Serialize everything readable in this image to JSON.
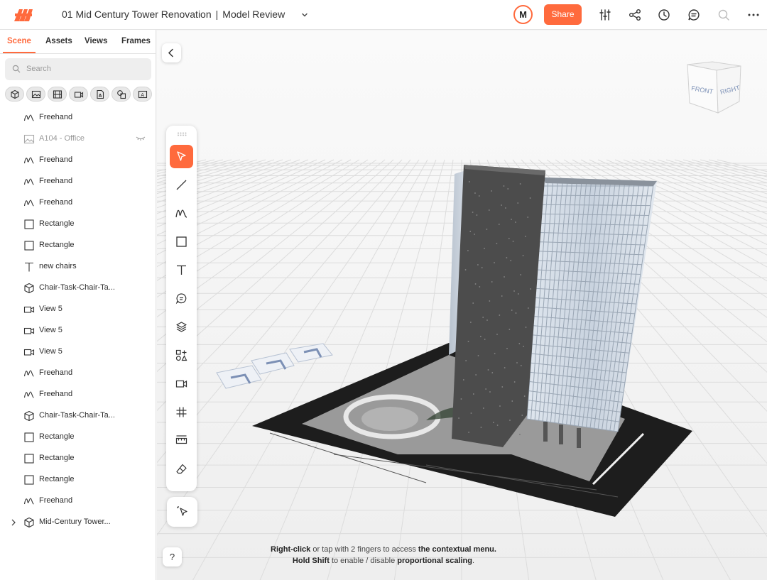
{
  "app": {
    "project_name": "01 Mid Century Tower Renovation",
    "separator": "|",
    "view_name": "Model Review"
  },
  "header": {
    "avatar_initial": "M",
    "share_label": "Share",
    "icons": [
      "settings-sliders-icon",
      "share-icon",
      "history-icon",
      "comment-icon",
      "search-icon",
      "more-icon"
    ]
  },
  "sidebar": {
    "tabs": [
      {
        "label": "Scene",
        "active": true
      },
      {
        "label": "Assets",
        "active": false
      },
      {
        "label": "Views",
        "active": false
      },
      {
        "label": "Frames",
        "active": false
      }
    ],
    "search_placeholder": "Search",
    "filters": [
      "model-filter-icon",
      "image-filter-icon",
      "film-filter-icon",
      "camera-filter-icon",
      "document-filter-icon",
      "shapes-filter-icon",
      "text-filter-icon"
    ],
    "layers": [
      {
        "icon": "freehand",
        "label": "Freehand"
      },
      {
        "icon": "image",
        "label": "A104 - Office",
        "hidden": true
      },
      {
        "icon": "freehand",
        "label": "Freehand"
      },
      {
        "icon": "freehand",
        "label": "Freehand"
      },
      {
        "icon": "freehand",
        "label": "Freehand"
      },
      {
        "icon": "rectangle",
        "label": "Rectangle"
      },
      {
        "icon": "rectangle",
        "label": "Rectangle"
      },
      {
        "icon": "text",
        "label": "new chairs"
      },
      {
        "icon": "cube",
        "label": "Chair-Task-Chair-Ta..."
      },
      {
        "icon": "camera",
        "label": "View 5"
      },
      {
        "icon": "camera",
        "label": "View 5"
      },
      {
        "icon": "camera",
        "label": "View 5"
      },
      {
        "icon": "freehand",
        "label": "Freehand"
      },
      {
        "icon": "freehand",
        "label": "Freehand"
      },
      {
        "icon": "cube",
        "label": "Chair-Task-Chair-Ta..."
      },
      {
        "icon": "rectangle",
        "label": "Rectangle"
      },
      {
        "icon": "rectangle",
        "label": "Rectangle"
      },
      {
        "icon": "rectangle",
        "label": "Rectangle"
      },
      {
        "icon": "freehand",
        "label": "Freehand"
      },
      {
        "icon": "cube",
        "label": "Mid-Century Tower...",
        "expandable": true
      }
    ]
  },
  "viewport": {
    "viewcube": {
      "front": "FRONT",
      "right": "RIGHT"
    },
    "tools": [
      "select",
      "line",
      "freehand",
      "rectangle",
      "text",
      "comment",
      "layers",
      "shapes",
      "camera",
      "grid",
      "measure",
      "eraser"
    ],
    "active_tool": "select",
    "help_label": "?",
    "hint": {
      "line1_bold1": "Right-click",
      "line1_text": " or tap with 2 fingers to access ",
      "line1_bold2": "the contextual menu.",
      "line2_bold1": "Hold Shift",
      "line2_text": " to enable / disable ",
      "line2_bold2": "proportional scaling",
      "line2_end": "."
    }
  },
  "colors": {
    "accent": "#ff6a3d"
  }
}
